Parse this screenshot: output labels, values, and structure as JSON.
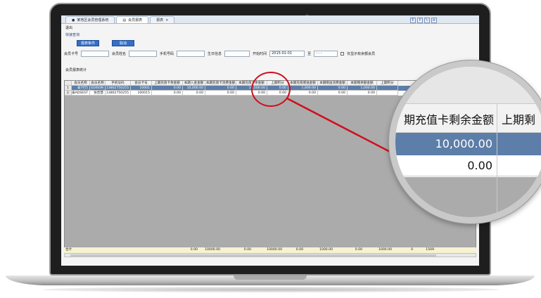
{
  "window": {
    "tabs": [
      {
        "label": "某地区会员管理系统"
      },
      {
        "label": "会员报表"
      },
      {
        "label": "报表"
      }
    ],
    "menu_exit": "退出",
    "section_title": "快速查询"
  },
  "buttons": {
    "query": "报表条件",
    "cancel": "取消"
  },
  "filters": {
    "card_label": "会员卡号",
    "name_label": "会员姓名",
    "phone_label": "手机号码",
    "birth_label": "生日信息",
    "start_label": "开始时间",
    "start_value": "2015-01-01",
    "to_label": "至",
    "end_value": "- - -",
    "checkbox_label": "仅显示有余额会员"
  },
  "grid": {
    "title": "会员报表统计",
    "columns": [
      "会员名称",
      "会员名称",
      "手机号码",
      "会员卡号",
      "上期充值卡余金额",
      "本期入金金额",
      "本期充值卡消费金额",
      "本期充值卡余金额",
      "上期积分",
      "本期充值赠送金额",
      "本期赠送消费金额",
      "本期赠余额金额",
      "上期积分"
    ],
    "rows": [
      {
        "num": "1",
        "cells": [
          "泰7行5",
          "EDISON",
          "13802750255",
          "10001",
          "0.00",
          "10,000.00",
          "0.00",
          "10,000.00",
          "0.00",
          "1,000.00",
          "0.00",
          "1,000.00"
        ]
      },
      {
        "num": "2",
        "cells": [
          "泰ADSEST",
          "张佳慧",
          "13802750255",
          "100015",
          "0.00",
          "0.00",
          "0.00",
          "0.00",
          "0.00",
          "0.00",
          "0.00",
          "0.00"
        ]
      }
    ],
    "total_label": "合计",
    "totals": [
      "0.00",
      "10000.00",
      "0.00",
      "10000.00",
      "0.00",
      "1000.00",
      "0.00",
      "1000.00",
      "0",
      "1509"
    ]
  },
  "magnifier": {
    "col_header": "期充值卡剩余金额",
    "col_header_next": "上期剩",
    "value_row1": "10,000.00",
    "value_row2": "0.00"
  },
  "colors": {
    "highlight_row": "#5c7ea8",
    "button": "#3470c4",
    "annotation_red": "#d10f1c"
  }
}
